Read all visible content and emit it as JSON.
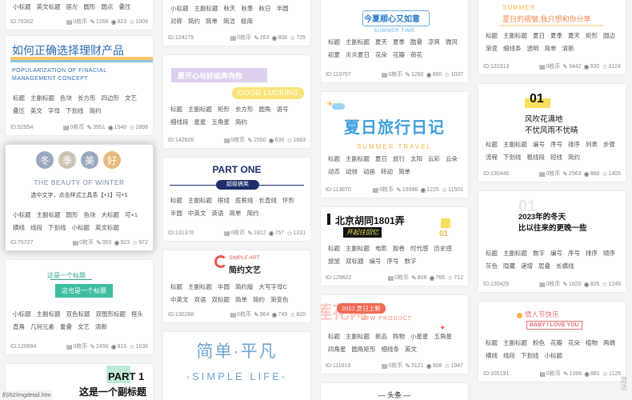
{
  "icons": {
    "coin": "coin-icon",
    "edit": "edit-icon",
    "view": "eye-icon",
    "star": "star-icon"
  },
  "cards": [
    {
      "id": "ID:76362",
      "tags": [
        "小标题",
        "英文标题",
        "居左",
        "圆形",
        "圆点",
        "叠压"
      ],
      "coins": "0枚币",
      "edits": "1268",
      "views": "823",
      "stars": "1009"
    },
    {
      "id": "ID:52954",
      "title": "如何正确选择理财产品",
      "subtitle1": "POPULARIZATION OF FINACIAL",
      "subtitle2": "MANAGEMENT CONCEPT",
      "tags": [
        "标题",
        "主副标题",
        "色块",
        "长方形",
        "四边形",
        "文艺",
        "叠压",
        "英文",
        "字母",
        "下划线",
        "简约"
      ],
      "coins": "0枚币",
      "edits": "3951",
      "views": "1540",
      "stars": "2898"
    },
    {
      "id": "ID:76727",
      "title_chars": [
        "冬",
        "季",
        "美",
        "好"
      ],
      "subtitle": "THE BEAUTY OF WINTER",
      "hint": "选中文字，点击样式工具条【+1】可+1",
      "tags": [
        "小标题",
        "主副标题",
        "圆形",
        "色块",
        "大标题",
        "可+1",
        "横线",
        "线段",
        "下划线",
        "小标题",
        "英文标题"
      ],
      "coins": "0枚币",
      "edits": "950",
      "views": "923",
      "stars": "972"
    },
    {
      "id": "ID:129684",
      "line1": "这是一个标题",
      "line2": "这也是一个标题",
      "tags": [
        "小标题",
        "主副标题",
        "双色标题",
        "双图形标题",
        "框头",
        "直角",
        "几何元素",
        "重叠",
        "文艺",
        "清新"
      ],
      "coins": "0枚币",
      "edits": "2496",
      "views": "815",
      "stars": "1636"
    },
    {
      "id": "",
      "title": "PART 1",
      "subtitle": "这是一个副标题",
      "tags": [],
      "coins": "",
      "edits": "",
      "views": "",
      "stars": ""
    },
    {
      "id": "ID:124275",
      "tags": [
        "对称",
        "简约",
        "简单",
        "简洁",
        "极简"
      ],
      "tags_top": [
        "小标题",
        "主副标题",
        "秋天",
        "秋季",
        "秋日",
        "半圆"
      ],
      "coins": "0枚币",
      "edits": "763",
      "views": "808",
      "stars": "725"
    },
    {
      "id": "ID:142826",
      "line1": "愿开心与好运奔向你",
      "line2": "GOOD LUCKING",
      "tags": [
        "标题",
        "主副标题",
        "矩形",
        "长方形",
        "圆角",
        "语号",
        "细线段",
        "星星",
        "五角星",
        "简约"
      ],
      "coins": "0枚币",
      "edits": "2550",
      "views": "636",
      "stars": "1683"
    },
    {
      "id": "ID:131370",
      "title": "PART ONE",
      "subtitle": "超级搞笑",
      "tags": [
        "标题",
        "主副标题",
        "框线",
        "底框线",
        "长直线",
        "环形",
        "半圆",
        "中英文",
        "英语",
        "简单",
        "简约"
      ],
      "coins": "0枚币",
      "edits": "1812",
      "views": "757",
      "stars": "1231"
    },
    {
      "id": "ID:130288",
      "sub": "SIMPLE ART",
      "title": "简约文艺",
      "tags": [
        "标题",
        "主副标题",
        "半圆",
        "简约版",
        "大写字母C",
        "中英文",
        "双语",
        "双标题",
        "简单",
        "简约",
        "渐变色"
      ],
      "coins": "0枚币",
      "edits": "964",
      "views": "749",
      "stars": "820"
    },
    {
      "id": "",
      "title": "简单·平凡",
      "subtitle": "-SIMPLE LIFE-",
      "tags": [],
      "coins": "",
      "edits": "",
      "views": "",
      "stars": ""
    },
    {
      "id": "ID:119757",
      "title": "今夏顺心又如意",
      "subtitle": "SUMMER TIME",
      "tags": [
        "标题",
        "主副标题",
        "夏天",
        "夏季",
        "酷暑",
        "凉爽",
        "微风",
        "初夏",
        "炎炎夏日",
        "花朵",
        "花瓣",
        "荷花"
      ],
      "coins": "0枚币",
      "edits": "1260",
      "views": "860",
      "stars": "1037"
    },
    {
      "id": "ID:113870",
      "title": "夏日旅行日记",
      "subtitle": "SUMMER TRAVEL",
      "tags": [
        "标题",
        "主副标题",
        "夏日",
        "旅行",
        "太阳",
        "云彩",
        "云朵",
        "动态",
        "动效",
        "动画",
        "转动",
        "简单"
      ],
      "coins": "0枚币",
      "edits": "19396",
      "views": "1225",
      "stars": "11501"
    },
    {
      "id": "ID:129622",
      "title": "北京胡同1801弄",
      "subtitle": "开起往回忆",
      "num": "01",
      "tags": [
        "标题",
        "主副标题",
        "电影",
        "胶卷",
        "时代感",
        "历史感",
        "旅旅",
        "双标题",
        "编号",
        "序号",
        "数字"
      ],
      "coins": "0枚币",
      "edits": "808",
      "views": "766",
      "stars": "712"
    },
    {
      "id": "ID:111619",
      "tag_top": "2022.夏日上新",
      "subtitle": "NEW PRODUCT",
      "watermark": "莲花网",
      "tags": [
        "标题",
        "主副标题",
        "新品",
        "购物",
        "小星星",
        "五角星",
        "四角星",
        "圆角矩形",
        "细线条",
        "英文"
      ],
      "coins": "0枚币",
      "edits": "3121",
      "views": "908",
      "stars": "1947"
    },
    {
      "id": "",
      "title": "— 头条 —",
      "tags": [],
      "coins": "",
      "edits": "",
      "views": "",
      "stars": ""
    },
    {
      "id": "ID:122313",
      "title1": "SUMMER",
      "title2": "夏日的褶皱,我只想和你分享",
      "tags": [
        "标题",
        "主副标题",
        "夏日",
        "夏季",
        "夏天",
        "矩形",
        "圆边",
        "渐变",
        "细线条",
        "透明",
        "简单",
        "清新"
      ],
      "coins": "0枚币",
      "edits": "3442",
      "views": "930",
      "stars": "3124"
    },
    {
      "id": "ID:130446",
      "num": "01",
      "line1": "风吹花满地",
      "line2": "不忧风雨不忧晴",
      "tags": [
        "标题",
        "主副标题",
        "编号",
        "序号",
        "排序",
        "列表",
        "步骤",
        "流程",
        "下划线",
        "粗线段",
        "短线",
        "简约"
      ],
      "coins": "0枚币",
      "edits": "2963",
      "views": "868",
      "stars": "1405"
    },
    {
      "id": "ID:130426",
      "num": "01",
      "line1": "2023年的冬天",
      "line2": "比以往来的更晚一些",
      "tags": [
        "标题",
        "主副标题",
        "数字",
        "编号",
        "序号",
        "排序",
        "顺序",
        "灰色",
        "隐藏",
        "递增",
        "层叠",
        "长横线"
      ],
      "coins": "0枚币",
      "edits": "1820",
      "views": "826",
      "stars": "1245"
    },
    {
      "id": "ID:105191",
      "line1": "情人节快乐",
      "line2": "BABY I LOVE YOU",
      "tags": [
        "标题",
        "主副标题",
        "粉色",
        "花瓣",
        "花朵",
        "植物",
        "两端",
        "横线",
        "线段",
        "下划线",
        "小标题"
      ],
      "coins": "0枚币",
      "edits": "1096",
      "views": "881",
      "stars": "1125"
    }
  ],
  "side_text": "激活",
  "status_url": "的/62/imgdetail.htm"
}
